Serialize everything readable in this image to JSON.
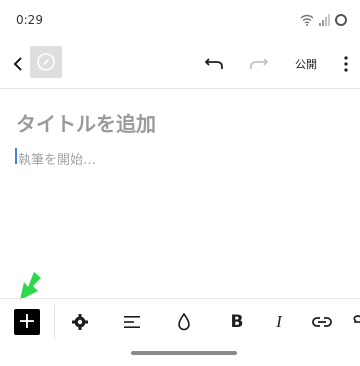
{
  "status_bar": {
    "time": "0:29"
  },
  "toolbar": {
    "publish_label": "公開"
  },
  "editor": {
    "title_placeholder": "タイトルを追加",
    "body_placeholder": "執筆を開始…"
  },
  "format_bar": {
    "add_label": "+",
    "bold_label": "B",
    "italic_label": "I"
  },
  "colors": {
    "accent_arrow": "#2bd94b",
    "add_button_bg": "#000000",
    "caret": "#4a7fd8"
  }
}
